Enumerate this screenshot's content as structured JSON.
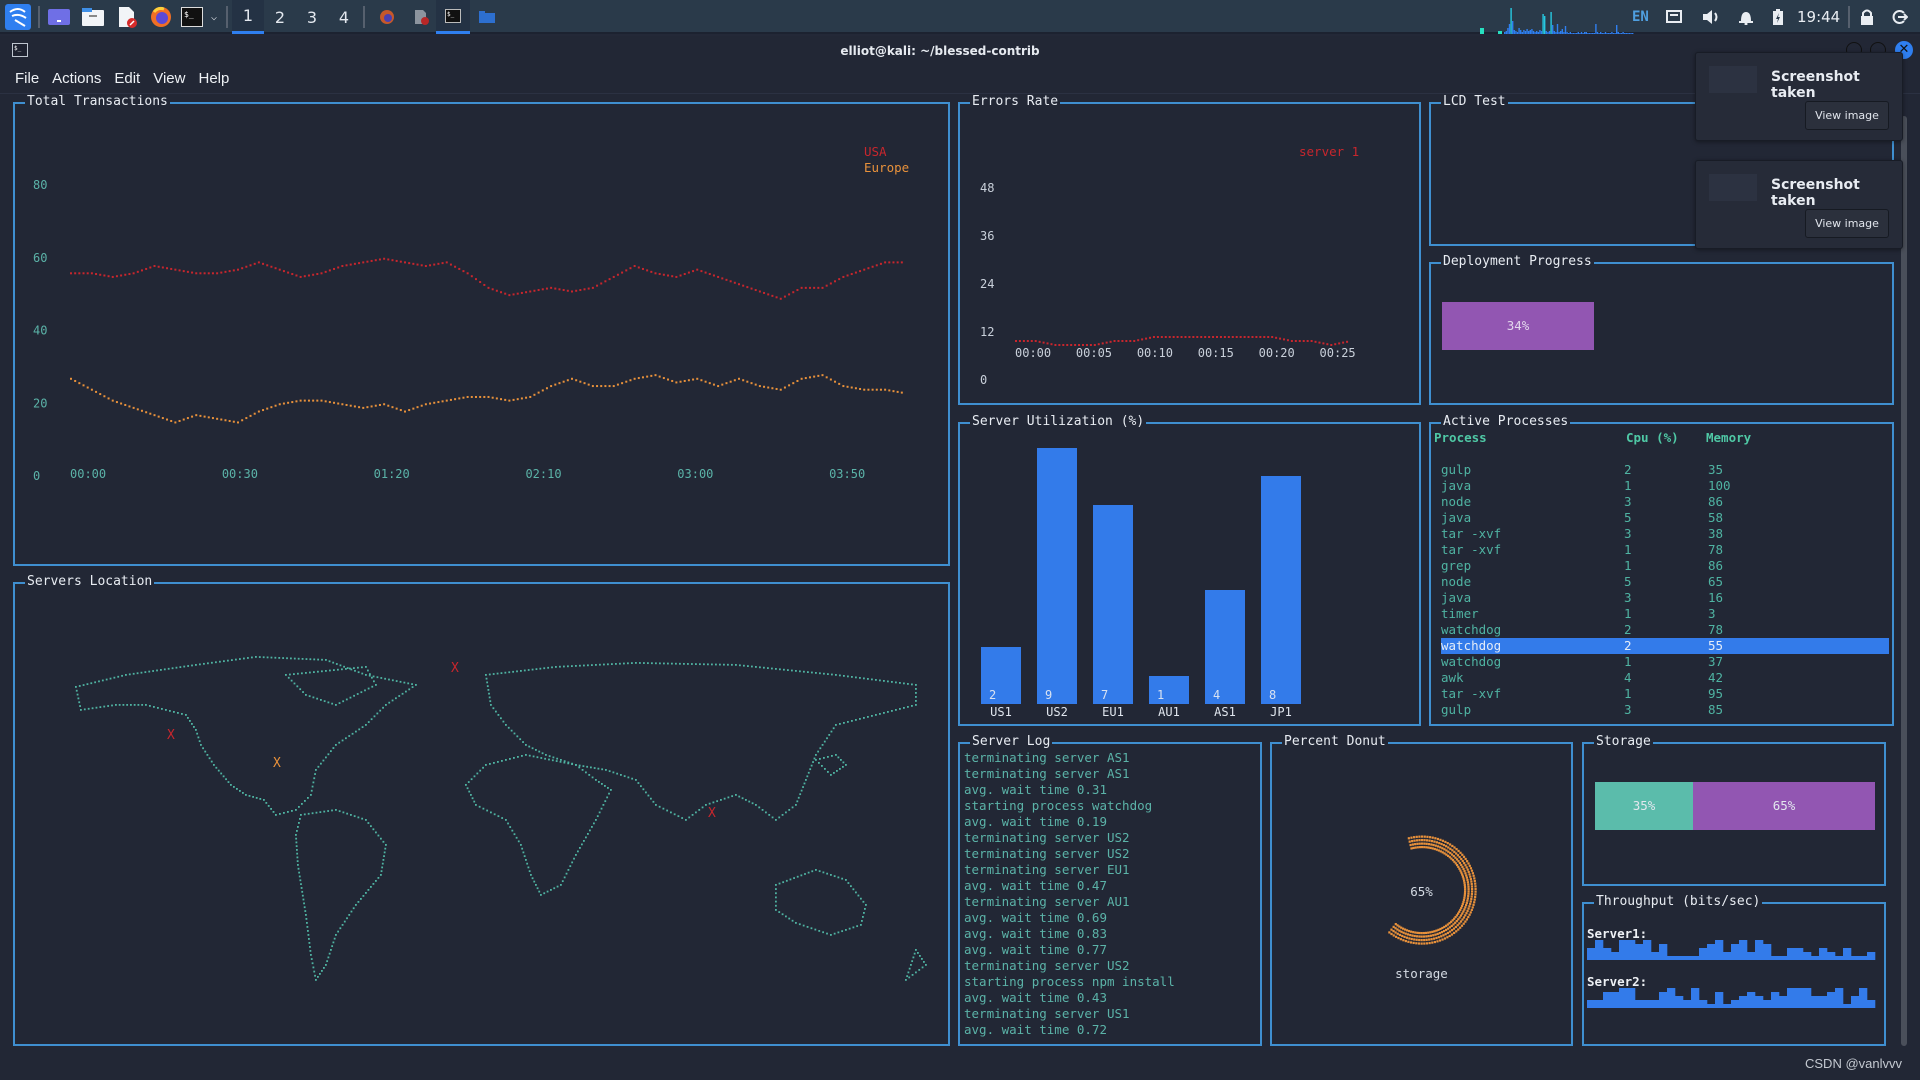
{
  "taskbar": {
    "workspaces": [
      "1",
      "2",
      "3",
      "4"
    ],
    "active_workspace": "1",
    "language": "EN",
    "clock": "19:44",
    "apps": [
      "kali-menu-icon",
      "desktop-icon",
      "file-manager-icon",
      "text-editor-icon",
      "firefox-icon",
      "terminal-icon"
    ],
    "tasks": [
      "firefox-task-icon",
      "text-editor-task-icon",
      "terminal-task-icon",
      "folder-task-icon"
    ]
  },
  "window": {
    "title": "elliot@kali: ~/blessed-contrib",
    "menu": [
      "File",
      "Actions",
      "Edit",
      "View",
      "Help"
    ]
  },
  "panels": {
    "total_transactions": "Total Transactions",
    "servers_location": "Servers Location",
    "errors_rate": "Errors Rate",
    "server_utilization": "Server Utilization (%)",
    "lcd_test": "LCD Test",
    "deployment_progress": "Deployment Progress",
    "active_processes": "Active Processes",
    "server_log": "Server Log",
    "percent_donut": "Percent Donut",
    "storage": "Storage",
    "throughput": "Throughput (bits/sec)"
  },
  "chart_data": [
    {
      "type": "line",
      "title": "Total Transactions",
      "x": [
        "00:00",
        "00:30",
        "01:20",
        "02:10",
        "03:00",
        "03:50"
      ],
      "ylim": [
        0,
        80
      ],
      "yticks": [
        "0",
        "20",
        "40",
        "60",
        "80"
      ],
      "legend": "top-right",
      "series": [
        {
          "name": "USA",
          "color": "#c8262d",
          "values": [
            56,
            56,
            55,
            56,
            58,
            57,
            56,
            56,
            57,
            59,
            57,
            55,
            56,
            58,
            59,
            60,
            59,
            58,
            59,
            56,
            52,
            50,
            51,
            52,
            51,
            52,
            55,
            58,
            56,
            55,
            57,
            55,
            53,
            51,
            49,
            52,
            52,
            55,
            57,
            59,
            59
          ]
        },
        {
          "name": "Europe",
          "color": "#e8913b",
          "values": [
            27,
            24,
            21,
            19,
            17,
            15,
            17,
            16,
            15,
            18,
            20,
            21,
            21,
            20,
            19,
            20,
            18,
            20,
            21,
            22,
            22,
            21,
            22,
            25,
            27,
            25,
            25,
            27,
            28,
            26,
            27,
            25,
            27,
            25,
            24,
            27,
            28,
            25,
            24,
            24,
            23
          ]
        }
      ]
    },
    {
      "type": "line",
      "title": "Errors Rate",
      "x": [
        "00:00",
        "00:05",
        "00:10",
        "00:15",
        "00:20",
        "00:25"
      ],
      "ylim": [
        0,
        48
      ],
      "yticks": [
        "0",
        "12",
        "24",
        "36",
        "48"
      ],
      "legend": "top-right",
      "series": [
        {
          "name": "server 1",
          "color": "#c8262d",
          "values": [
            10,
            10,
            9,
            9,
            9,
            10,
            10,
            11,
            11,
            11,
            11,
            11,
            11,
            11,
            10,
            10,
            9,
            10
          ]
        }
      ]
    },
    {
      "type": "bar",
      "title": "Server Utilization (%)",
      "categories": [
        "US1",
        "US2",
        "EU1",
        "AU1",
        "AS1",
        "JP1"
      ],
      "values": [
        2,
        9,
        7,
        1,
        4,
        8
      ],
      "ylim": [
        0,
        9
      ],
      "color": "#337bea"
    },
    {
      "type": "pie",
      "title": "Percent Donut",
      "label": "storage",
      "values": [
        65
      ],
      "display": "65%",
      "color": "#e8913b"
    },
    {
      "type": "bar",
      "title": "Storage",
      "stacked": true,
      "segments": [
        {
          "value": 35,
          "label": "35%",
          "color": "#5bbcab"
        },
        {
          "value": 65,
          "label": "65%",
          "color": "#9256b2"
        }
      ]
    },
    {
      "type": "bar",
      "title": "Throughput (bits/sec)",
      "series": [
        {
          "name": "Server1:",
          "values": [
            2,
            4,
            2,
            1,
            4,
            4,
            3,
            4,
            1,
            3,
            0,
            0,
            0,
            0,
            2,
            3,
            4,
            1,
            3,
            4,
            1,
            4,
            3,
            0,
            0,
            2,
            2,
            1,
            0,
            2,
            1,
            0,
            2,
            0,
            0,
            1
          ]
        },
        {
          "name": "Server2:",
          "values": [
            1,
            1,
            3,
            3,
            4,
            4,
            1,
            1,
            1,
            3,
            4,
            2,
            1,
            4,
            1,
            0,
            3,
            0,
            1,
            2,
            3,
            2,
            1,
            3,
            2,
            4,
            4,
            4,
            2,
            2,
            3,
            4,
            0,
            2,
            4,
            1
          ]
        }
      ]
    }
  ],
  "deployment_progress": {
    "value": 34,
    "label": "34%",
    "color": "#9256b2"
  },
  "processes": {
    "headers": [
      "Process",
      "Cpu (%)",
      "Memory"
    ],
    "selected_index": 11,
    "rows": [
      [
        "gulp",
        "2",
        "35"
      ],
      [
        "java",
        "1",
        "100"
      ],
      [
        "node",
        "3",
        "86"
      ],
      [
        "java",
        "5",
        "58"
      ],
      [
        "tar -xvf",
        "3",
        "38"
      ],
      [
        "tar -xvf",
        "1",
        "78"
      ],
      [
        "grep",
        "1",
        "86"
      ],
      [
        "node",
        "5",
        "65"
      ],
      [
        "java",
        "3",
        "16"
      ],
      [
        "timer",
        "1",
        "3"
      ],
      [
        "watchdog",
        "2",
        "78"
      ],
      [
        "watchdog",
        "2",
        "55"
      ],
      [
        "watchdog",
        "1",
        "37"
      ],
      [
        "awk",
        "4",
        "42"
      ],
      [
        "tar -xvf",
        "1",
        "95"
      ],
      [
        "gulp",
        "3",
        "85"
      ]
    ]
  },
  "server_log": [
    "terminating server AS1",
    "terminating server AS1",
    "avg. wait time 0.31",
    "starting process watchdog",
    "avg. wait time 0.19",
    "terminating server US2",
    "terminating server US2",
    "terminating server EU1",
    "avg. wait time 0.47",
    "terminating server AU1",
    "avg. wait time 0.69",
    "avg. wait time 0.83",
    "avg. wait time 0.77",
    "terminating server US2",
    "starting process npm install",
    "avg. wait time 0.43",
    "terminating server US1",
    "avg. wait time 0.72"
  ],
  "map": {
    "markers": [
      {
        "label": "X",
        "color": "#c8262d",
        "region": "US West"
      },
      {
        "label": "X",
        "color": "#e8913b",
        "region": "US East"
      },
      {
        "label": "X",
        "color": "#c8262d",
        "region": "Europe"
      },
      {
        "label": "X",
        "color": "#c8262d",
        "region": "Southeast Asia"
      }
    ]
  },
  "notifications": [
    {
      "title": "Screenshot taken",
      "button": "View image"
    },
    {
      "title": "Screenshot taken",
      "button": "View image"
    }
  ],
  "watermark": "CSDN @vanlvvv"
}
